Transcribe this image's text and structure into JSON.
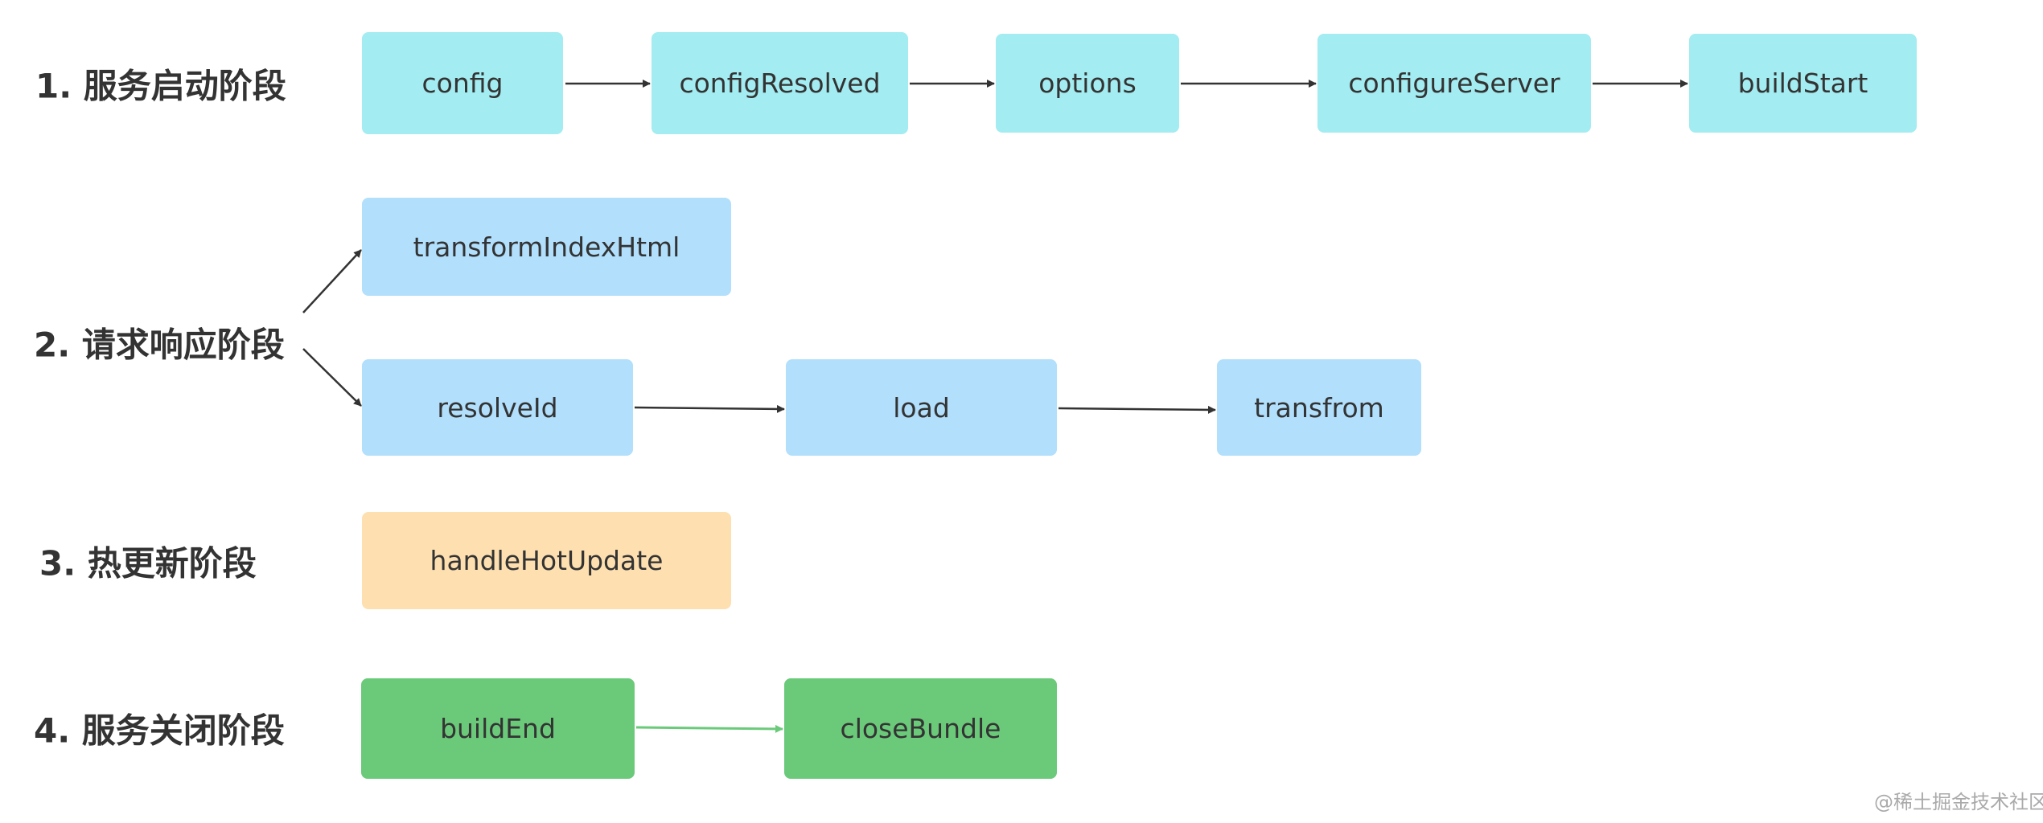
{
  "stages": [
    {
      "label": "1. 服务启动阶段",
      "nodes": [
        "config",
        "configResolved",
        "options",
        "configureServer",
        "buildStart"
      ],
      "color": "#a3ecf1"
    },
    {
      "label": "2. 请求响应阶段",
      "nodes": [
        "transformIndexHtml",
        "resolveId",
        "load",
        "transfrom"
      ],
      "color": "#b1dffc"
    },
    {
      "label": "3. 热更新阶段",
      "nodes": [
        "handleHotUpdate"
      ],
      "color": "#fee0b0"
    },
    {
      "label": "4. 服务关闭阶段",
      "nodes": [
        "buildEnd",
        "closeBundle"
      ],
      "color": "#6bca7a"
    }
  ],
  "watermark": "@稀土掘金技术社区"
}
